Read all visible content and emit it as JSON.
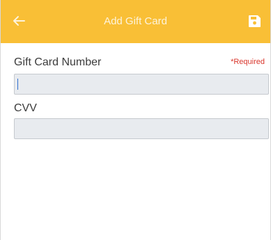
{
  "app_bar": {
    "title": "Add Gift Card",
    "background": "#f9bf36",
    "back_icon": "arrow-left-icon",
    "save_icon": "floppy-disk-icon"
  },
  "form": {
    "gift_card_number": {
      "label": "Gift Card Number",
      "required_text": "*Required",
      "value": "",
      "focused": true
    },
    "cvv": {
      "label": "CVV",
      "value": ""
    }
  },
  "colors": {
    "accent": "#f9bf36",
    "required": "#d9362c",
    "input_background": "#e8ebef",
    "caret": "#2f6fd0"
  }
}
